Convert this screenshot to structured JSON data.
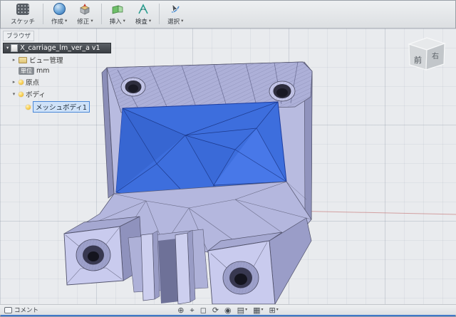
{
  "toolbar": {
    "sketch_label": "スケッチ",
    "caret": "▾",
    "menus": [
      {
        "label": "作成"
      },
      {
        "label": "修正"
      },
      {
        "label": "挿入"
      },
      {
        "label": "検査"
      },
      {
        "label": "選択"
      }
    ]
  },
  "browser": {
    "panel_label": "ブラウザ",
    "document_title": "X_carriage_lm_ver_a v1",
    "views_label": "ビュー管理",
    "units_chip": "単位",
    "units_value": "mm",
    "origin_label": "原点",
    "bodies_label": "ボディ",
    "mesh_body_label": "メッシュボディ1"
  },
  "viewcube": {
    "front": "前",
    "right": "右"
  },
  "bottom_bar": {
    "comment_label": "コメント",
    "nav_icons": [
      {
        "name": "pan",
        "glyph": "⊕"
      },
      {
        "name": "zoom",
        "glyph": "⌖"
      },
      {
        "name": "fit",
        "glyph": "◻"
      },
      {
        "name": "orbit",
        "glyph": "⟳"
      },
      {
        "name": "look-at",
        "glyph": "◉"
      },
      {
        "name": "display-settings",
        "glyph": "▤"
      },
      {
        "name": "grid-settings",
        "glyph": "▦"
      },
      {
        "name": "viewport-layout",
        "glyph": "⊞"
      }
    ]
  },
  "icons": {
    "caret_down": "▾",
    "caret_right": "▸"
  },
  "colors": {
    "selection_blue": "#3d6edd",
    "body_lavender": "#c9cbee",
    "canvas_bg": "#e9ebee",
    "doc_row_bg": "#3b3f44",
    "selected_row_bg": "#cfe2f8",
    "accent_strip": "#3f78c8"
  }
}
